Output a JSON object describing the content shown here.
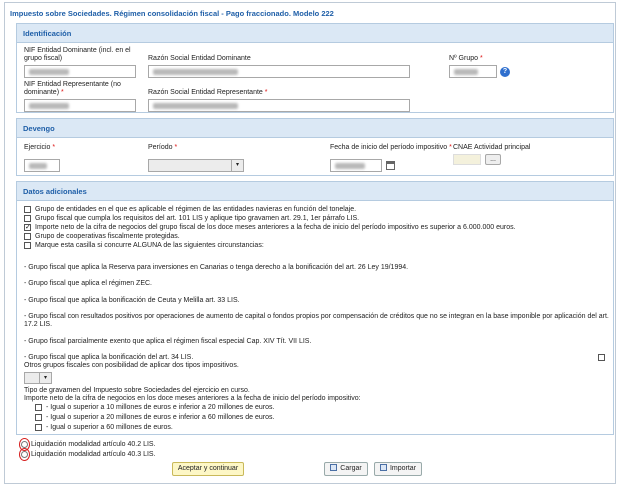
{
  "page_title": "Impuesto sobre Sociedades. Régimen consolidación fiscal - Pago fraccionado. Modelo 222",
  "identificacion": {
    "heading": "Identificación",
    "nif_dominante_label": "NIF Entidad Dominante (incl. en el grupo fiscal)",
    "razon_dominante_label": "Razón Social Entidad Dominante",
    "n_grupo_label": "Nº Grupo",
    "nif_representante_label": "NIF Entidad Representante (no dominante)",
    "razon_representante_label": "Razón Social Entidad Representante",
    "required_mark": "*",
    "help_icon_text": "?"
  },
  "devengo": {
    "heading": "Devengo",
    "ejercicio_label": "Ejercicio",
    "periodo_label": "Período",
    "fecha_inicio_label": "Fecha de inicio del período impositivo",
    "cnae_label": "CNAE Actividad principal",
    "ellipsis_button": "...",
    "dropdown_glyph": "▾"
  },
  "datos_adicionales": {
    "heading": "Datos adicionales",
    "checks": [
      {
        "label": "Grupo de entidades en el que es aplicable el régimen de las entidades navieras en función del tonelaje.",
        "checked": false
      },
      {
        "label": "Grupo fiscal que cumpla los requisitos del art. 101 LIS y aplique tipo gravamen art. 29.1, 1er párrafo LIS.",
        "checked": false
      },
      {
        "label": "Importe neto de la cifra de negocios del grupo fiscal de los doce meses anteriores a la fecha de inicio del período impositivo es superior a 6.000.000 euros.",
        "checked": true
      },
      {
        "label": "Grupo de cooperativas fiscalmente protegidas.",
        "checked": false
      },
      {
        "label": "Marque esta casilla si concurre ALGUNA de las siguientes circunstancias:",
        "checked": false
      }
    ],
    "circumstances": [
      "- Grupo fiscal que aplica la Reserva para inversiones en Canarias o tenga derecho a la bonificación del art. 26 Ley 19/1994.",
      "- Grupo fiscal que aplica el régimen ZEC.",
      "- Grupo fiscal que aplica la bonificación de Ceuta y Melilla art. 33 LIS.",
      "- Grupo fiscal con resultados positivos por operaciones de aumento de capital o fondos propios por compensación de créditos que no se integran en la base imponible por aplicación del art.",
      "17.2 LIS.",
      "- Grupo fiscal parcialmente exento que aplica el régimen fiscal especial Cap. XIV Tít. VII LIS.",
      "- Grupo fiscal que aplica la bonificación del art. 34 LIS."
    ],
    "otros_grupos_label": "Otros grupos fiscales con posibilidad de aplicar dos tipos impositivos.",
    "tipo_gravamen_label": "Tipo de gravamen del Impuesto sobre Sociedades del ejercicio en curso.",
    "importe_neto_label": "Importe neto de la cifra de negocios en los doce meses anteriores a la fecha de inicio del período impositivo:",
    "importe_options": [
      "- Igual o superior a 10 millones de euros e inferior a 20 millones de euros.",
      "- Igual o superior a 20 millones de euros e inferior a 60 millones de euros.",
      "- Igual o superior a 60 millones de euros."
    ]
  },
  "liquidacion": [
    "Liquidación modalidad artículo 40.2 LIS.",
    "Liquidación modalidad artículo 40.3 LIS."
  ],
  "buttons": {
    "aceptar": "Aceptar y continuar",
    "cargar": "Cargar",
    "importar": "Importar"
  }
}
